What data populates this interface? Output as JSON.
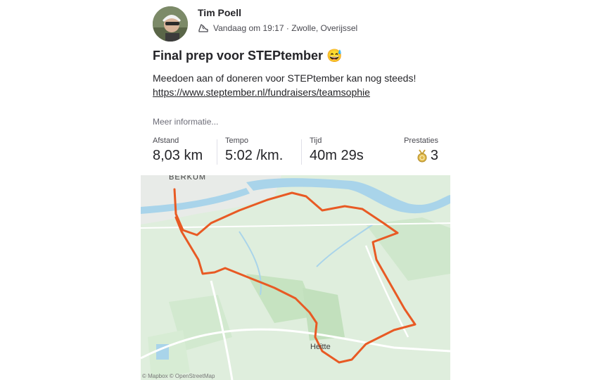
{
  "activity": {
    "athlete_name": "Tim Poell",
    "meta_text": "Vandaag om 19:17 · Zwolle, Overijssel",
    "activity_type_icon": "running-shoe-icon",
    "title": "Final prep voor STEPtember 😅",
    "description_line1": "Meedoen aan of doneren voor STEPtember kan nog steeds!",
    "description_link": "https://www.steptember.nl/fundraisers/teamsophie",
    "more_info": "Meer informatie..."
  },
  "stats": [
    {
      "label": "Afstand",
      "value": "8,03 km"
    },
    {
      "label": "Tempo",
      "value": "5:02 /km."
    },
    {
      "label": "Tijd",
      "value": "40m 29s"
    }
  ],
  "achievements": {
    "label": "Prestaties",
    "count": "3",
    "icon": "medal-icon"
  },
  "map": {
    "place_labels": [
      "BERKUM",
      "Heitte"
    ],
    "attribution": "© Mapbox © OpenStreetMap",
    "route_color": "#e85a24",
    "water_color": "#a9d4ea",
    "land_color": "#dfeedd",
    "field_color": "#c8e6c4"
  }
}
